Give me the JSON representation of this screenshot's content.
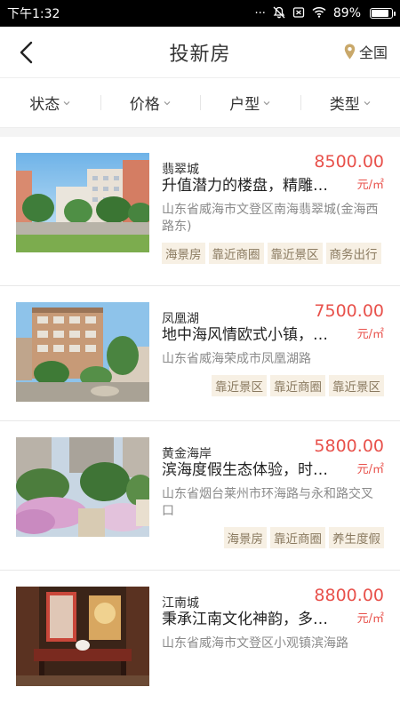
{
  "status": {
    "time": "下午1:32",
    "battery": "89%",
    "battery_level": 0.89,
    "icons": [
      "more-dots-icon",
      "silent-bell-icon",
      "sim-icon",
      "wifi-icon",
      "battery-icon"
    ]
  },
  "header": {
    "title": "投新房",
    "location": "全国"
  },
  "filters": [
    "状态",
    "价格",
    "户型",
    "类型"
  ],
  "listings": [
    {
      "name": "翡翠城",
      "price": "8500.00",
      "unit": "元/㎡",
      "title": "升值潜力的楼盘，精雕细琢",
      "address": "山东省威海市文登区南海翡翠城(金海西路东)",
      "tags": [
        "海景房",
        "靠近商圈",
        "靠近景区",
        "商务出行"
      ]
    },
    {
      "name": "凤凰湖",
      "price": "7500.00",
      "unit": "元/㎡",
      "title": "地中海风情欧式小镇，宜居",
      "address": "山东省威海荣成市凤凰湖路",
      "tags": [
        "靠近景区",
        "靠近商圈",
        "靠近景区"
      ]
    },
    {
      "name": "黄金海岸",
      "price": "5800.00",
      "unit": "元/㎡",
      "title": "滨海度假生态体验，时尚生活",
      "address": "山东省烟台莱州市环海路与永和路交叉口",
      "tags": [
        "海景房",
        "靠近商圈",
        "养生度假"
      ]
    },
    {
      "name": "江南城",
      "price": "8800.00",
      "unit": "元/㎡",
      "title": "秉承江南文化神韵，多元生活",
      "address": "山东省威海市文登区小观镇滨海路",
      "tags": []
    }
  ]
}
